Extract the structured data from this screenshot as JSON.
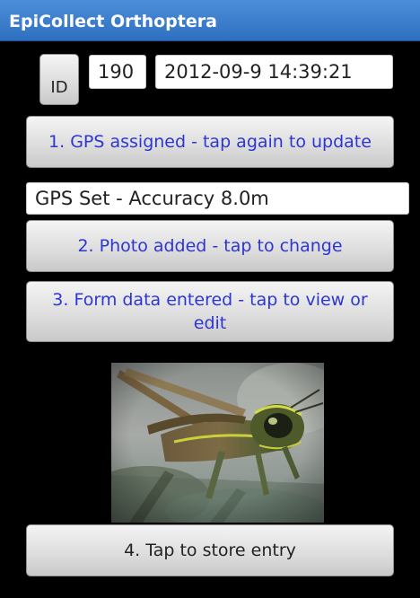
{
  "app": {
    "title": "EpiCollect Orthoptera"
  },
  "header": {
    "id_label": "ID",
    "id_value": "190",
    "timestamp": "2012-09-9 14:39:21"
  },
  "steps": {
    "gps_button": "1. GPS assigned - tap again to update",
    "gps_status": "GPS Set - Accuracy 8.0m",
    "photo_button": "2. Photo added - tap to change",
    "form_button": "3. Form data entered - tap to view or edit",
    "store_button": "4. Tap to store entry"
  },
  "photo": {
    "subject": "grasshopper-photo"
  },
  "colors": {
    "titlebar": "#3a7dcc",
    "button_text_blue": "#2e36d1"
  }
}
